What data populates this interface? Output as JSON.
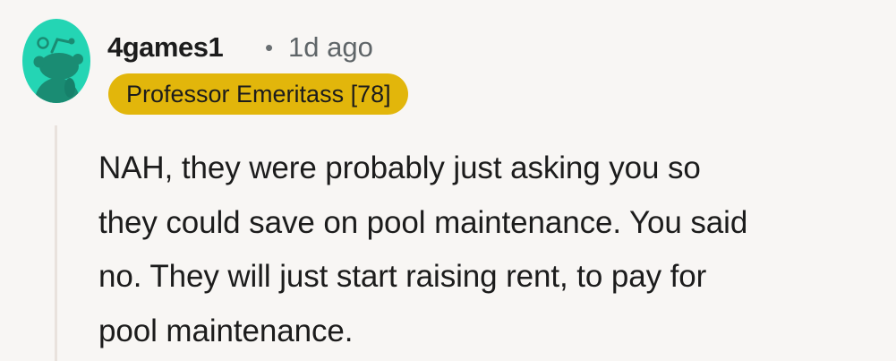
{
  "comment": {
    "author": "4games1",
    "separator": "•",
    "timestamp": "1d ago",
    "flair": "Professor Emeritass [78]",
    "body_lines": [
      "NAH, they were probably just asking you so",
      "they could save on pool maintenance. You said",
      "no. They will just start raising rent, to pay for",
      "pool maintenance."
    ],
    "avatar_icon": "snoo-avatar-icon",
    "colors": {
      "avatar_bg": "#24d5b4",
      "flair_bg": "#e2b60b",
      "background": "#f8f6f4",
      "thread_line": "#e9e2dd"
    }
  }
}
